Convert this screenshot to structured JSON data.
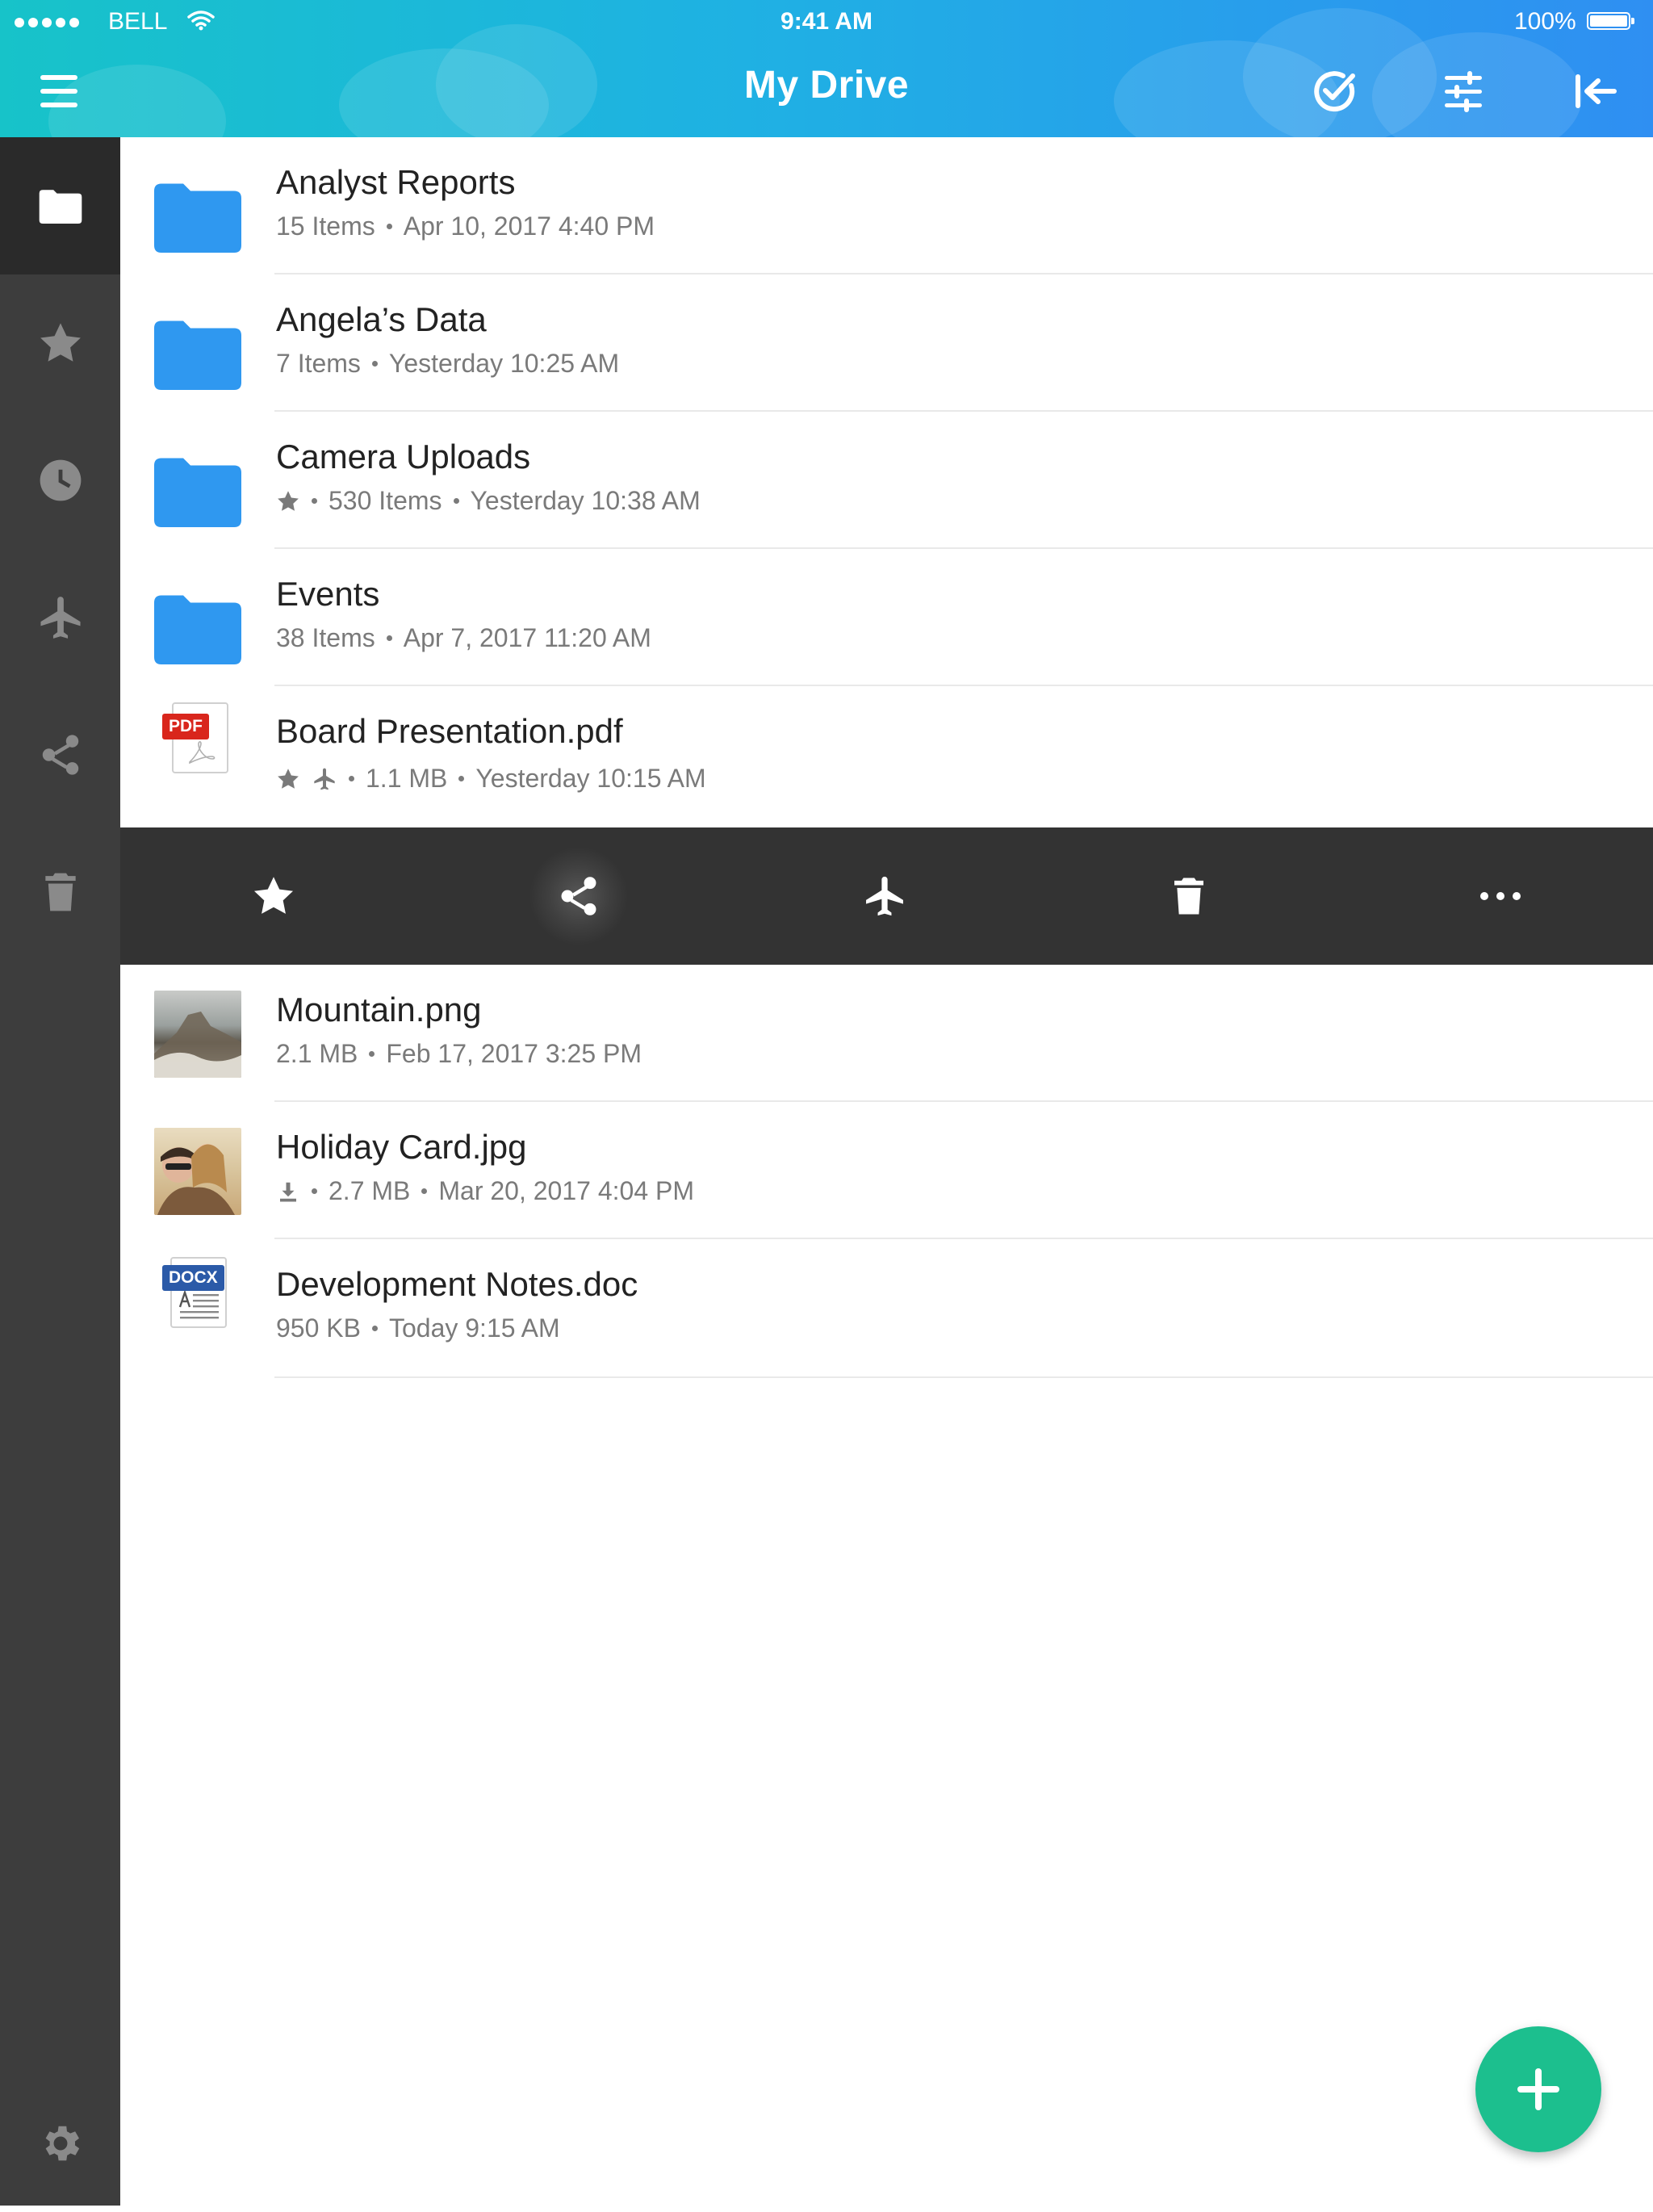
{
  "status_bar": {
    "carrier": "BELL",
    "time": "9:41 AM",
    "battery": "100%"
  },
  "header": {
    "title": "My Drive"
  },
  "sidebar": {
    "items": [
      {
        "icon": "folder-icon",
        "active": true
      },
      {
        "icon": "star-icon"
      },
      {
        "icon": "clock-icon"
      },
      {
        "icon": "airplane-icon"
      },
      {
        "icon": "share-icon"
      },
      {
        "icon": "trash-icon"
      },
      {
        "icon": "gear-icon"
      }
    ]
  },
  "files": [
    {
      "name": "Analyst Reports",
      "type": "folder",
      "items": "15 Items",
      "date": "Apr 10, 2017 4:40 PM"
    },
    {
      "name": "Angela’s Data",
      "type": "folder",
      "items": "7 Items",
      "date": "Yesterday 10:25 AM"
    },
    {
      "name": "Camera Uploads",
      "type": "folder",
      "starred": true,
      "items": "530 Items",
      "date": "Yesterday 10:38 AM"
    },
    {
      "name": "Events",
      "type": "folder",
      "items": "38 Items",
      "date": "Apr 7, 2017 11:20 AM"
    },
    {
      "name": "Board Presentation.pdf",
      "type": "pdf",
      "badge": "PDF",
      "starred": true,
      "offline": true,
      "size": "1.1 MB",
      "date": "Yesterday 10:15 AM"
    },
    {
      "name": "Mountain.png",
      "type": "image",
      "size": "2.1 MB",
      "date": "Feb 17, 2017 3:25 PM"
    },
    {
      "name": "Holiday Card.jpg",
      "type": "image",
      "downloaded": true,
      "size": "2.7 MB",
      "date": "Mar 20, 2017 4:04 PM"
    },
    {
      "name": "Development Notes.doc",
      "type": "docx",
      "badge": "DOCX",
      "size": "950 KB",
      "date": "Today 9:15 AM"
    }
  ],
  "action_bar": {
    "actions": [
      "star-icon",
      "share-icon",
      "airplane-icon",
      "trash-icon",
      "more-icon"
    ]
  },
  "colors": {
    "header_start": "#17c3c9",
    "header_end": "#2f8ff2",
    "sidebar": "#3d3d3d",
    "action_bar": "#333333",
    "folder": "#2f98f0",
    "fab": "#1cbf8e",
    "pdf_badge": "#d9261c",
    "docx_badge": "#2b5aa8"
  }
}
